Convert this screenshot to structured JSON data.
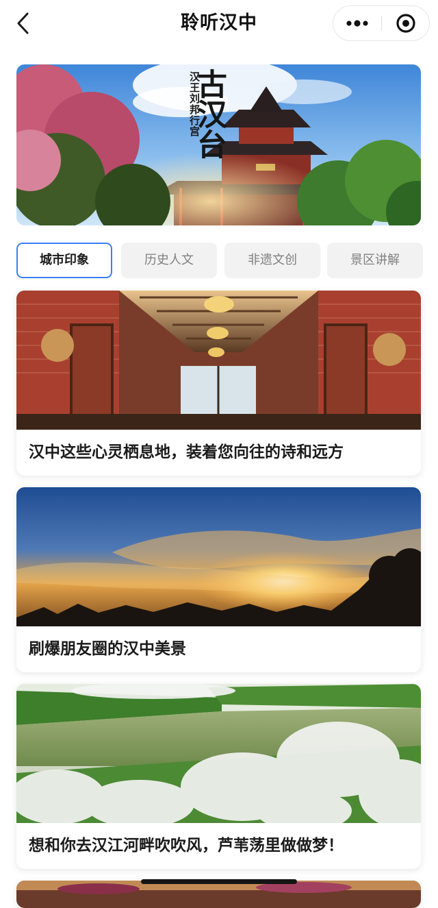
{
  "nav": {
    "title": "聆听汉中",
    "back_icon": "chevron-left-icon",
    "more_icon": "more-dots-icon",
    "target_icon": "target-icon"
  },
  "banner": {
    "title": "古汉台",
    "caption": "汉王刘邦行宫"
  },
  "tabs": [
    {
      "label": "城市印象",
      "active": true
    },
    {
      "label": "历史人文",
      "active": false
    },
    {
      "label": "非遗文创",
      "active": false
    },
    {
      "label": "景区讲解",
      "active": false
    }
  ],
  "articles": [
    {
      "title": "汉中这些心灵栖息地，装着您向往的诗和远方"
    },
    {
      "title": "刷爆朋友圈的汉中美景"
    },
    {
      "title": "想和你去汉江河畔吹吹风，芦苇荡里做做梦！"
    }
  ],
  "colors": {
    "accent": "#3c7ef6",
    "tab_bg": "#f2f2f2",
    "tab_text": "#808080"
  }
}
